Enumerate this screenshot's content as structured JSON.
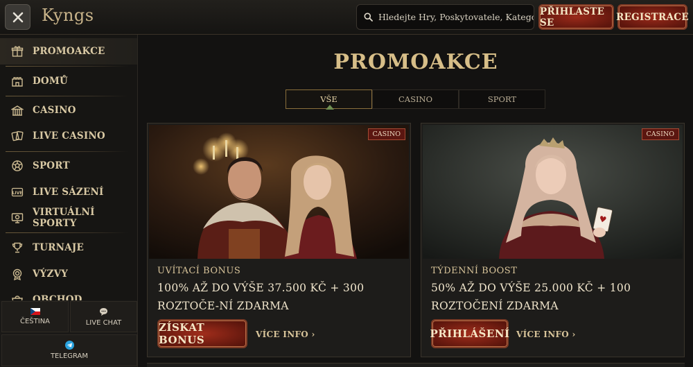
{
  "header": {
    "logo": "Kyngs",
    "search_placeholder": "Hledejte Hry, Poskytovatele, Kategorie",
    "login_label": "PŘIHLASTE SE",
    "register_label": "REGISTRACE"
  },
  "sidebar": {
    "items": [
      {
        "label": "PROMOAKCE",
        "icon": "gift-icon"
      },
      {
        "label": "DOMŮ",
        "icon": "castle-icon"
      },
      {
        "label": "CASINO",
        "icon": "casino-icon"
      },
      {
        "label": "LIVE CASINO",
        "icon": "cards-icon"
      },
      {
        "label": "SPORT",
        "icon": "soccer-ball-icon"
      },
      {
        "label": "LIVE SÁZENÍ",
        "icon": "live-icon"
      },
      {
        "label": "VIRTUÁLNÍ SPORTY",
        "icon": "virtual-sports-icon"
      },
      {
        "label": "TURNAJE",
        "icon": "trophy-icon"
      },
      {
        "label": "VÝZVY",
        "icon": "challenge-icon"
      },
      {
        "label": "OBCHOD",
        "icon": "shop-icon"
      }
    ],
    "language_label": "ČEŠTINA",
    "live_chat_label": "LIVE CHAT",
    "telegram_label": "TELEGRAM"
  },
  "main": {
    "title": "PROMOAKCE",
    "tabs": [
      {
        "label": "VŠE",
        "active": true
      },
      {
        "label": "CASINO",
        "active": false
      },
      {
        "label": "SPORT",
        "active": false
      }
    ],
    "cards": [
      {
        "badge": "CASINO",
        "subtitle": "UVÍTACÍ BONUS",
        "title": "100% AŽ DO VÝŠE 37.500 KČ + 300 ROZTOČE-NÍ ZDARMA",
        "button": "ZÍSKAT BONUS",
        "more": "VÍCE INFO"
      },
      {
        "badge": "CASINO",
        "subtitle": "TÝDENNÍ BOOST",
        "title": "50% AŽ DO VÝŠE 25.000 KČ + 100 ROZTOČENÍ ZDARMA",
        "button": "PŘIHLÁŠENÍ",
        "more": "VÍCE INFO"
      }
    ]
  },
  "colors": {
    "accent_gold": "#d7be88",
    "button_red": "#8a2416",
    "background": "#131211"
  }
}
